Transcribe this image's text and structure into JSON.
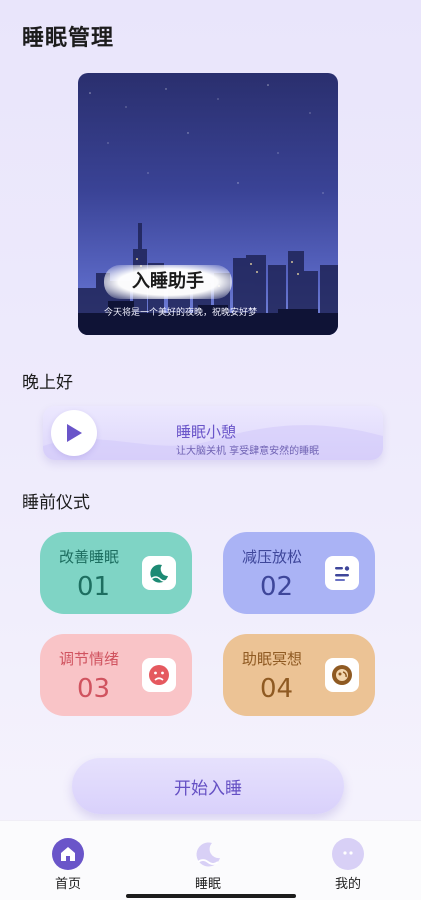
{
  "header": {
    "title": "睡眠管理"
  },
  "banner": {
    "title": "入睡助手",
    "subtitle": "今天将是一个美好的夜晚，祝晚安好梦"
  },
  "greeting": "晚上好",
  "nap": {
    "title": "睡眠小憩",
    "subtitle": "让大脑关机 享受肆意安然的睡眠",
    "icon": "play-icon"
  },
  "rituals": {
    "title": "睡前仪式",
    "items": [
      {
        "label": "改善睡眠",
        "number": "01",
        "icon": "moon-icon",
        "color": "#7fd4c5"
      },
      {
        "label": "减压放松",
        "number": "02",
        "icon": "relax-face-icon",
        "color": "#aab3f5"
      },
      {
        "label": "调节情绪",
        "number": "03",
        "icon": "sad-face-icon",
        "color": "#f9c4c7"
      },
      {
        "label": "助眠冥想",
        "number": "04",
        "icon": "meditation-icon",
        "color": "#ecc395"
      }
    ]
  },
  "start_button": "开始入睡",
  "tabbar": {
    "items": [
      {
        "label": "首页",
        "icon": "home-icon",
        "active": true
      },
      {
        "label": "睡眠",
        "icon": "sleep-moon-icon",
        "active": false
      },
      {
        "label": "我的",
        "icon": "profile-face-icon",
        "active": false
      }
    ]
  },
  "colors": {
    "accent": "#6a55c9",
    "active_tab": "#6a55c9",
    "inactive_tab": "#d8d0f6"
  }
}
